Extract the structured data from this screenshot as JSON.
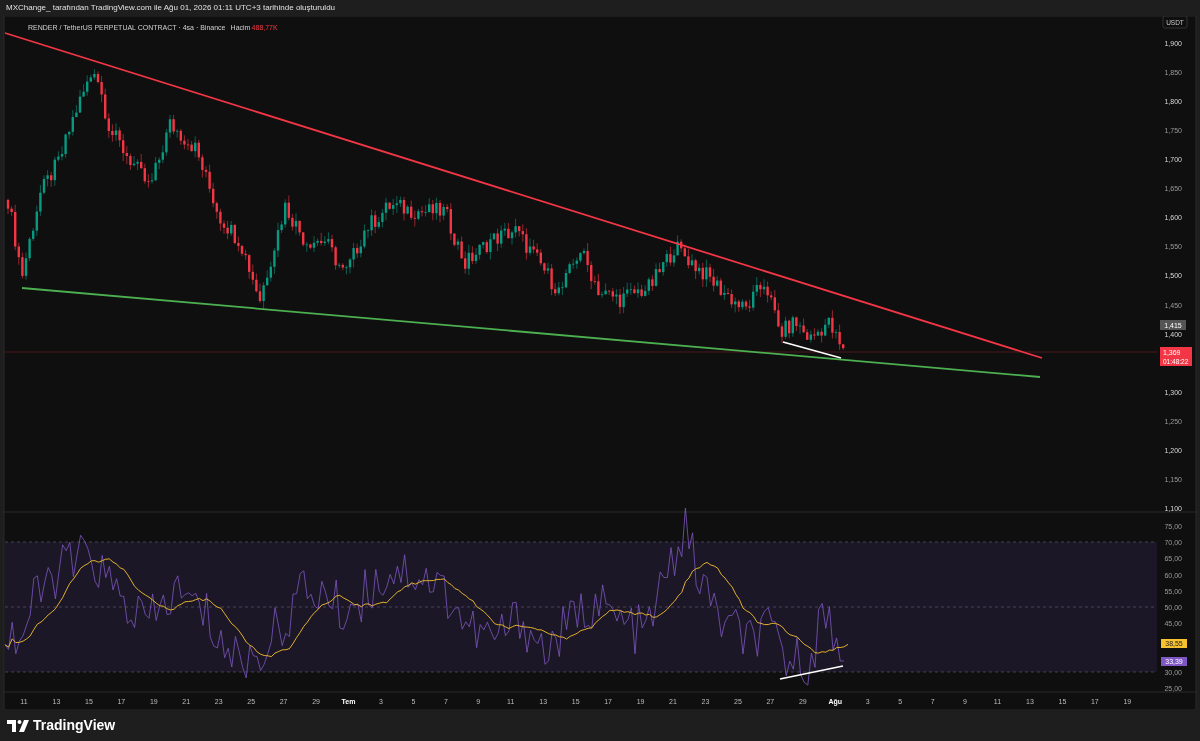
{
  "header": {
    "credit": "MXChange_ tarafından TradingView.com ile Ağu 01, 2026 01:11 UTC+3 tarihinde oluşturuldu"
  },
  "legend": {
    "symbol": "RENDER / TetherUS PERPETUAL CONTRACT · 4sa · Binance",
    "volume_label": "Hacim",
    "volume_value": "488,77K"
  },
  "price_axis": {
    "currency": "USDT",
    "ticks": [
      "1,900",
      "1,850",
      "1,800",
      "1,750",
      "1,700",
      "1,650",
      "1,600",
      "1,550",
      "1,500",
      "1,450",
      "1,400",
      "1,300",
      "1,250",
      "1,200",
      "1,150",
      "1,100"
    ],
    "labels": [
      {
        "kind": "marker",
        "text": "1,415"
      },
      {
        "kind": "last",
        "text": "1,369",
        "countdown": "01:48:22"
      }
    ]
  },
  "rsi_axis": {
    "ticks": [
      "75,00",
      "70,00",
      "65,00",
      "60,00",
      "55,00",
      "50,00",
      "45,00",
      "30,00",
      "25,00"
    ],
    "labels": [
      {
        "text": "38,55",
        "color": "#f7c12f"
      },
      {
        "text": "33,39",
        "color": "#7e57c2"
      }
    ]
  },
  "time_axis": [
    "11",
    "13",
    "15",
    "17",
    "19",
    "21",
    "23",
    "25",
    "27",
    "29",
    "Tem",
    "3",
    "5",
    "7",
    "9",
    "11",
    "13",
    "15",
    "17",
    "19",
    "21",
    "23",
    "25",
    "27",
    "29",
    "Ağu",
    "3",
    "5",
    "7",
    "9",
    "11",
    "13",
    "15",
    "17",
    "19"
  ],
  "footer": {
    "logo": "TradingView"
  }
}
